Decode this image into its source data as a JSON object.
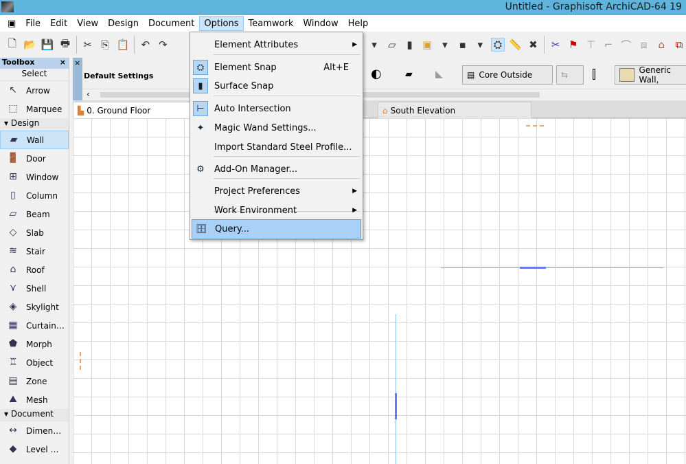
{
  "window": {
    "title": "Untitled - Graphisoft ArchiCAD-64 19"
  },
  "menubar": [
    "File",
    "Edit",
    "View",
    "Design",
    "Document",
    "Options",
    "Teamwork",
    "Window",
    "Help"
  ],
  "toolbox": {
    "title": "Toolbox",
    "close": "×",
    "select_label": "Select",
    "select_items": [
      {
        "label": "Arrow",
        "icon": "↖"
      },
      {
        "label": "Marquee",
        "icon": "⬚"
      }
    ],
    "design_label": "Design",
    "design_items": [
      {
        "label": "Wall",
        "icon": "▰"
      },
      {
        "label": "Door",
        "icon": "🚪"
      },
      {
        "label": "Window",
        "icon": "⊞"
      },
      {
        "label": "Column",
        "icon": "▯"
      },
      {
        "label": "Beam",
        "icon": "▱"
      },
      {
        "label": "Slab",
        "icon": "◇"
      },
      {
        "label": "Stair",
        "icon": "≋"
      },
      {
        "label": "Roof",
        "icon": "⌂"
      },
      {
        "label": "Shell",
        "icon": "⋎"
      },
      {
        "label": "Skylight",
        "icon": "◈"
      },
      {
        "label": "Curtain…",
        "icon": "▦"
      },
      {
        "label": "Morph",
        "icon": "⬟"
      },
      {
        "label": "Object",
        "icon": "♖"
      },
      {
        "label": "Zone",
        "icon": "▤"
      },
      {
        "label": "Mesh",
        "icon": "⛰"
      }
    ],
    "document_label": "Document",
    "document_items": [
      {
        "label": "Dimen…",
        "icon": "↔"
      },
      {
        "label": "Level …",
        "icon": "◆"
      }
    ]
  },
  "infobox": {
    "title": "Default Settings",
    "close": "×",
    "core": "Core Outside",
    "material": "Generic Wall,"
  },
  "tabs": [
    {
      "label": "0. Ground Floor"
    },
    {
      "label": "South Elevation"
    }
  ],
  "options_menu": [
    {
      "label": "Element Attributes",
      "submenu": true
    },
    {
      "label": "Element Snap",
      "shortcut": "Alt+E",
      "checked": true
    },
    {
      "label": "Surface Snap",
      "checked": true
    },
    {
      "label": "Auto Intersection",
      "checked": true
    },
    {
      "label": "Magic Wand Settings..."
    },
    {
      "label": "Import Standard Steel Profile..."
    },
    {
      "label": "Add-On Manager..."
    },
    {
      "label": "Project Preferences",
      "submenu": true
    },
    {
      "label": "Work Environment",
      "submenu": true
    },
    {
      "label": "Query...",
      "highlighted": true
    }
  ],
  "colors": {
    "titlebar": "#5fb4dc",
    "highlight": "#a9d1f7"
  }
}
